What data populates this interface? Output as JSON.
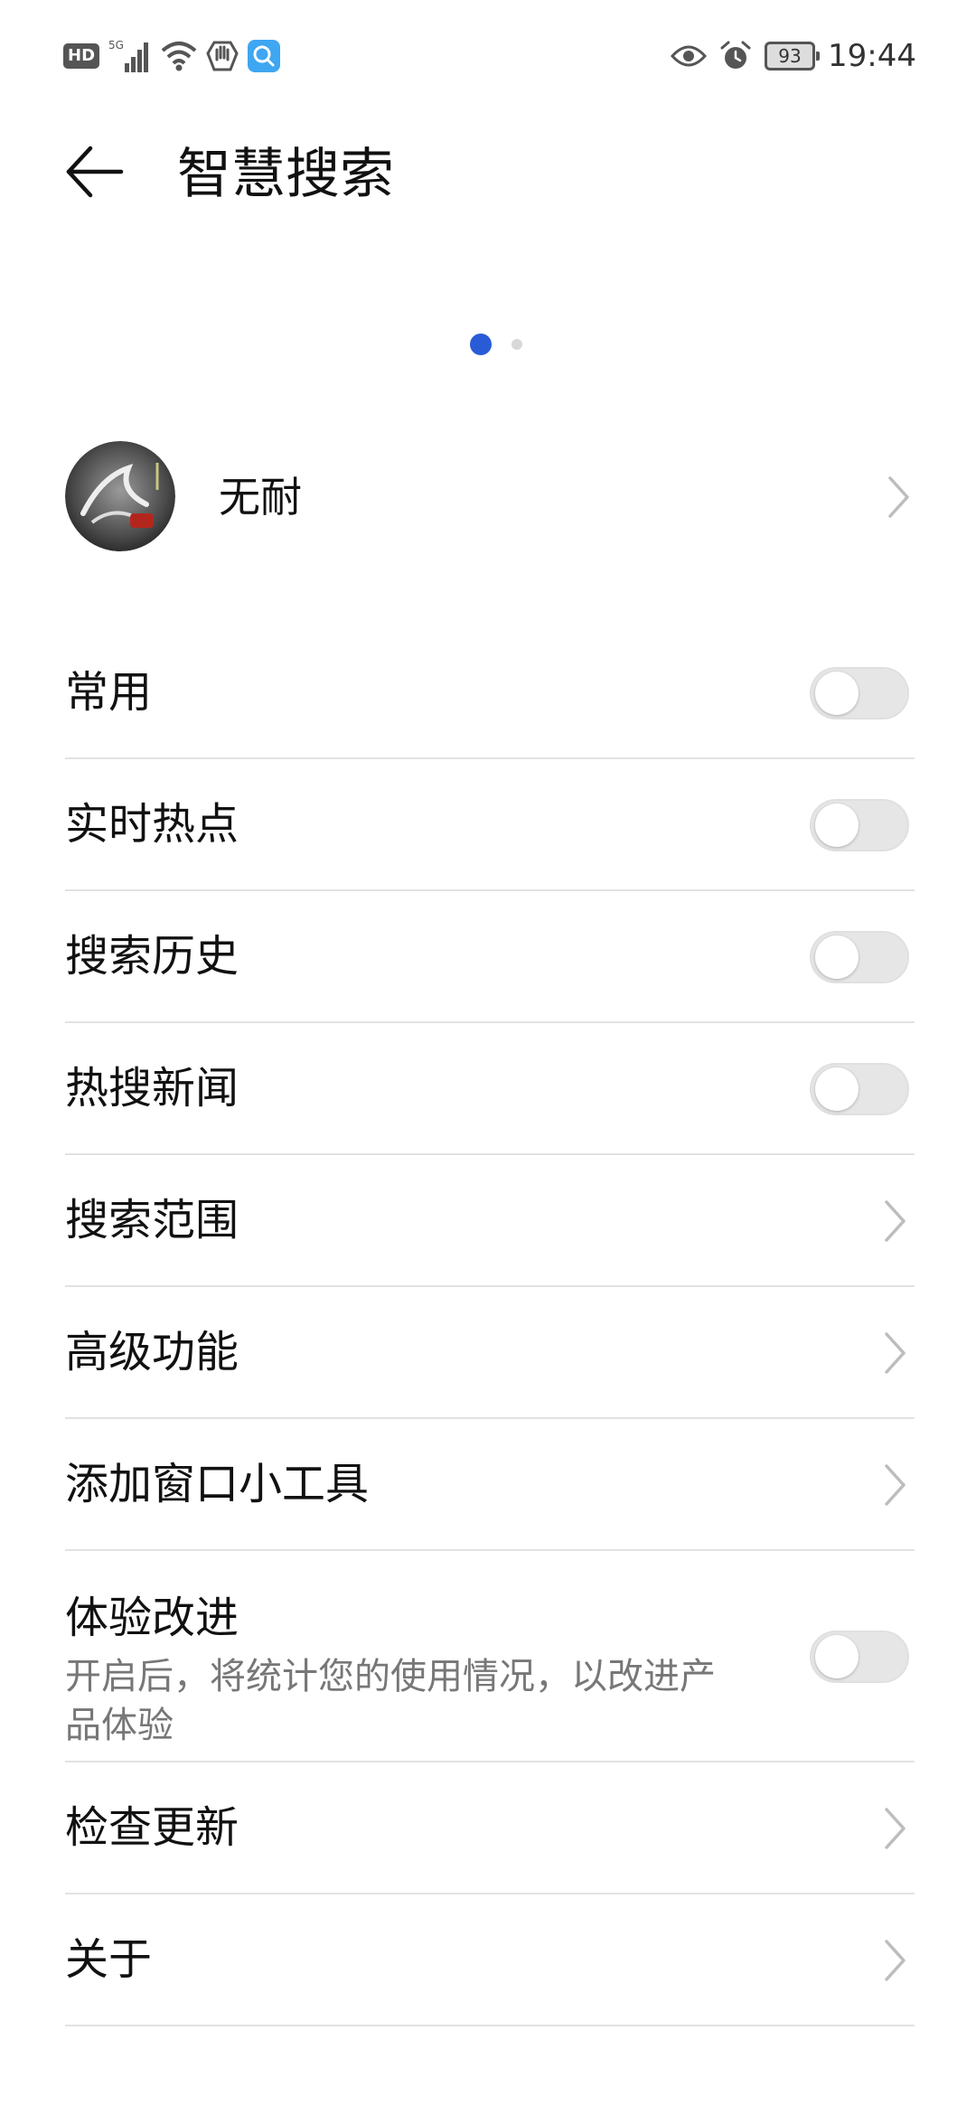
{
  "status_bar": {
    "hd": "HD",
    "network": "5G",
    "battery": "93",
    "time": "19:44"
  },
  "header": {
    "title": "智慧搜索"
  },
  "pager": {
    "current_page": 1,
    "total_pages": 2
  },
  "account": {
    "name": "无耐"
  },
  "settings": {
    "items": [
      {
        "label": "常用",
        "type": "toggle",
        "on": false
      },
      {
        "label": "实时热点",
        "type": "toggle",
        "on": false
      },
      {
        "label": "搜索历史",
        "type": "toggle",
        "on": false
      },
      {
        "label": "热搜新闻",
        "type": "toggle",
        "on": false
      },
      {
        "label": "搜索范围",
        "type": "link"
      },
      {
        "label": "高级功能",
        "type": "link"
      },
      {
        "label": "添加窗口小工具",
        "type": "link"
      },
      {
        "label": "体验改进",
        "desc": "开启后，将统计您的使用情况，以改进产品体验",
        "type": "toggle",
        "on": false
      },
      {
        "label": "检查更新",
        "type": "link"
      },
      {
        "label": "关于",
        "type": "link"
      }
    ]
  },
  "colors": {
    "accent": "#2a5bd7",
    "toggle_off": "#e6e6e6",
    "divider": "#e2e2e2"
  }
}
